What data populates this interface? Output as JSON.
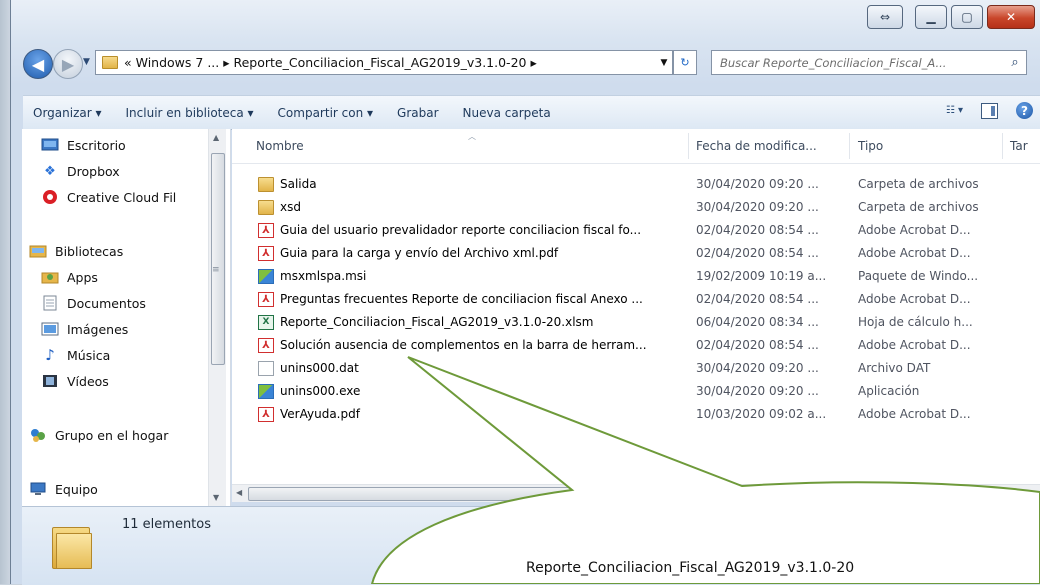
{
  "window": {
    "caption_buttons": [
      "snap-icon",
      "minimize-icon",
      "maximize-icon",
      "close-icon"
    ]
  },
  "nav": {
    "back_icon": "back-arrow-icon",
    "forward_icon": "forward-arrow-icon"
  },
  "address": {
    "breadcrumb": "« Windows 7 ...  ▸  Reporte_Conciliacion_Fiscal_AG2019_v3.1.0-20  ▸",
    "icon": "folder-icon"
  },
  "search": {
    "placeholder": "Buscar Reporte_Conciliacion_Fiscal_A...",
    "icon": "search-icon"
  },
  "toolbar": {
    "organizar": "Organizar ▾",
    "incluir": "Incluir en biblioteca ▾",
    "compartir": "Compartir con ▾",
    "grabar": "Grabar",
    "nueva_carpeta": "Nueva carpeta"
  },
  "sidebar": {
    "items": [
      {
        "label": "Escritorio",
        "icon": "desktop-icon"
      },
      {
        "label": "Dropbox",
        "icon": "dropbox-icon"
      },
      {
        "label": "Creative Cloud Fil",
        "icon": "creative-cloud-icon"
      },
      {
        "label": "Bibliotecas",
        "icon": "libraries-icon"
      },
      {
        "label": "Apps",
        "icon": "apps-icon"
      },
      {
        "label": "Documentos",
        "icon": "documents-icon"
      },
      {
        "label": "Imágenes",
        "icon": "pictures-icon"
      },
      {
        "label": "Música",
        "icon": "music-icon"
      },
      {
        "label": "Vídeos",
        "icon": "videos-icon"
      },
      {
        "label": "Grupo en el hogar",
        "icon": "homegroup-icon"
      },
      {
        "label": "Equipo",
        "icon": "computer-icon"
      }
    ]
  },
  "columns": {
    "name": "Nombre",
    "date": "Fecha de modifica...",
    "type": "Tipo",
    "size": "Tar"
  },
  "files": [
    {
      "name": "Salida",
      "date": "30/04/2020 09:20 ...",
      "type": "Carpeta de archivos",
      "icon": "folder"
    },
    {
      "name": "xsd",
      "date": "30/04/2020 09:20 ...",
      "type": "Carpeta de archivos",
      "icon": "folder"
    },
    {
      "name": "Guia del usuario prevalidador reporte conciliacion fiscal fo...",
      "date": "02/04/2020 08:54 ...",
      "type": "Adobe Acrobat D...",
      "icon": "pdf"
    },
    {
      "name": "Guia para la carga y envío del Archivo xml.pdf",
      "date": "02/04/2020 08:54 ...",
      "type": "Adobe Acrobat D...",
      "icon": "pdf"
    },
    {
      "name": "msxmlspa.msi",
      "date": "19/02/2009 10:19 a...",
      "type": "Paquete de Windo...",
      "icon": "msi"
    },
    {
      "name": "Preguntas frecuentes Reporte de conciliacion fiscal Anexo ...",
      "date": "02/04/2020 08:54 ...",
      "type": "Adobe Acrobat D...",
      "icon": "pdf"
    },
    {
      "name": "Reporte_Conciliacion_Fiscal_AG2019_v3.1.0-20.xlsm",
      "date": "06/04/2020 08:34 ...",
      "type": "Hoja de cálculo h...",
      "icon": "xls"
    },
    {
      "name": "Solución ausencia de complementos en la barra de herram...",
      "date": "02/04/2020 08:54 ...",
      "type": "Adobe Acrobat D...",
      "icon": "pdf"
    },
    {
      "name": "unins000.dat",
      "date": "30/04/2020 09:20 ...",
      "type": "Archivo DAT",
      "icon": "blank"
    },
    {
      "name": "unins000.exe",
      "date": "30/04/2020 09:20 ...",
      "type": "Aplicación",
      "icon": "msi"
    },
    {
      "name": "VerAyuda.pdf",
      "date": "10/03/2020 09:02 a...",
      "type": "Adobe Acrobat D...",
      "icon": "pdf"
    }
  ],
  "status": {
    "count": "11 elementos",
    "icon": "folder-icon"
  },
  "callout": {
    "text": "Reporte_Conciliacion_Fiscal_AG2019_v3.1.0-20"
  }
}
